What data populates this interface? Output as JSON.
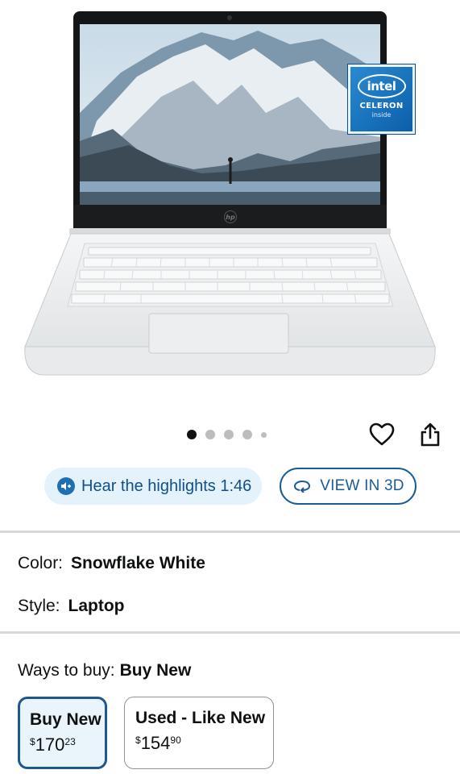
{
  "product_image": {
    "badge": {
      "brand": "intel",
      "line1": "CELERON",
      "line2": "inside"
    },
    "logo_text": "hp"
  },
  "carousel": {
    "count": 5,
    "active_index": 0
  },
  "actions": {
    "favorite_icon": "heart-icon",
    "share_icon": "share-icon"
  },
  "buttons": {
    "highlights": "Hear the highlights 1:46",
    "view3d": "VIEW IN 3D"
  },
  "variations": {
    "color": {
      "label": "Color:",
      "value": "Snowflake White"
    },
    "style": {
      "label": "Style:",
      "value": "Laptop"
    }
  },
  "ways_to_buy": {
    "label": "Ways to buy:",
    "selected": "Buy New",
    "options": [
      {
        "title": "Buy New",
        "currency": "$",
        "dollars": "170",
        "cents": "23",
        "selected": true
      },
      {
        "title": "Used - Like New",
        "currency": "$",
        "dollars": "154",
        "cents": "90",
        "selected": false
      }
    ]
  },
  "colors": {
    "accent": "#1a5b97",
    "pill_bg": "#e4f2fb",
    "divider": "#d5d9d9"
  }
}
